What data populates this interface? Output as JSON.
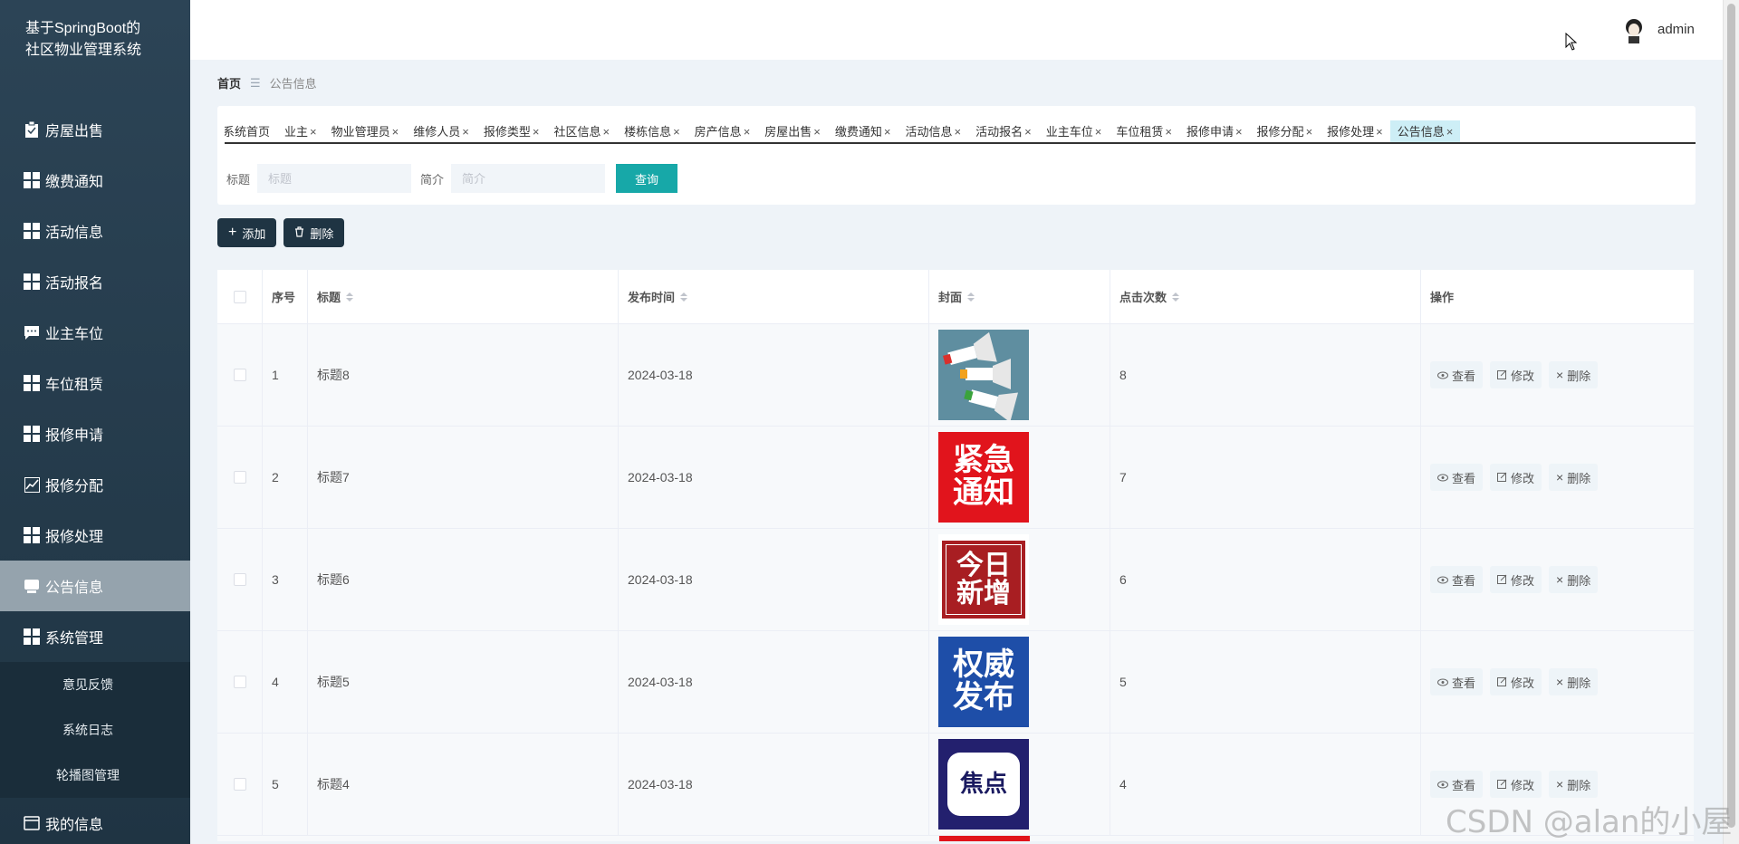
{
  "app": {
    "brand": "基于SpringBoot的社区物业管理系统"
  },
  "sidebar": {
    "items": [
      {
        "label": "房屋出售",
        "icon": "clipboard-icon"
      },
      {
        "label": "缴费通知",
        "icon": "grid-icon"
      },
      {
        "label": "活动信息",
        "icon": "grid-icon"
      },
      {
        "label": "活动报名",
        "icon": "grid-icon"
      },
      {
        "label": "业主车位",
        "icon": "chat-icon"
      },
      {
        "label": "车位租赁",
        "icon": "grid-icon"
      },
      {
        "label": "报修申请",
        "icon": "grid-icon"
      },
      {
        "label": "报修分配",
        "icon": "chart-icon"
      },
      {
        "label": "报修处理",
        "icon": "grid-icon"
      },
      {
        "label": "公告信息",
        "icon": "monitor-icon",
        "active": true
      },
      {
        "label": "系统管理",
        "icon": "grid-icon"
      }
    ],
    "sub_items": [
      "意见反馈",
      "系统日志",
      "轮播图管理"
    ],
    "bottom_item": {
      "label": "我的信息",
      "icon": "card-icon"
    }
  },
  "header": {
    "username": "admin"
  },
  "breadcrumb": {
    "home": "首页",
    "current": "公告信息"
  },
  "tabs": [
    "系统首页",
    "业主",
    "物业管理员",
    "维修人员",
    "报修类型",
    "社区信息",
    "楼栋信息",
    "房产信息",
    "房屋出售",
    "缴费通知",
    "活动信息",
    "活动报名",
    "业主车位",
    "车位租赁",
    "报修申请",
    "报修分配",
    "报修处理",
    "公告信息"
  ],
  "search": {
    "title_label": "标题",
    "title_placeholder": "标题",
    "intro_label": "简介",
    "intro_placeholder": "简介",
    "query_label": "查询"
  },
  "actions": {
    "add_label": "添加",
    "delete_label": "删除"
  },
  "table": {
    "columns": [
      "序号",
      "标题",
      "发布时间",
      "封面",
      "点击次数",
      "操作"
    ],
    "rows": [
      {
        "idx": "1",
        "title": "标题8",
        "time": "2024-03-18",
        "cover": "megaphone",
        "clicks": "8"
      },
      {
        "idx": "2",
        "title": "标题7",
        "time": "2024-03-18",
        "cover_text": [
          "紧急",
          "通知"
        ],
        "clicks": "7"
      },
      {
        "idx": "3",
        "title": "标题6",
        "time": "2024-03-18",
        "cover_text": [
          "今日",
          "新增"
        ],
        "clicks": "6"
      },
      {
        "idx": "4",
        "title": "标题5",
        "time": "2024-03-18",
        "cover_text": [
          "权威",
          "发布"
        ],
        "clicks": "5"
      },
      {
        "idx": "5",
        "title": "标题4",
        "time": "2024-03-18",
        "cover_text": [
          "焦点"
        ],
        "clicks": "4"
      }
    ],
    "ops": {
      "view": "查看",
      "edit": "修改",
      "delete": "删除"
    }
  },
  "watermark": "CSDN @alan的小屋",
  "colors": {
    "sidebar": "#2c4456",
    "accent": "#17a8a8",
    "dark_button": "#1f3443",
    "active_tab": "#cdeef6"
  }
}
